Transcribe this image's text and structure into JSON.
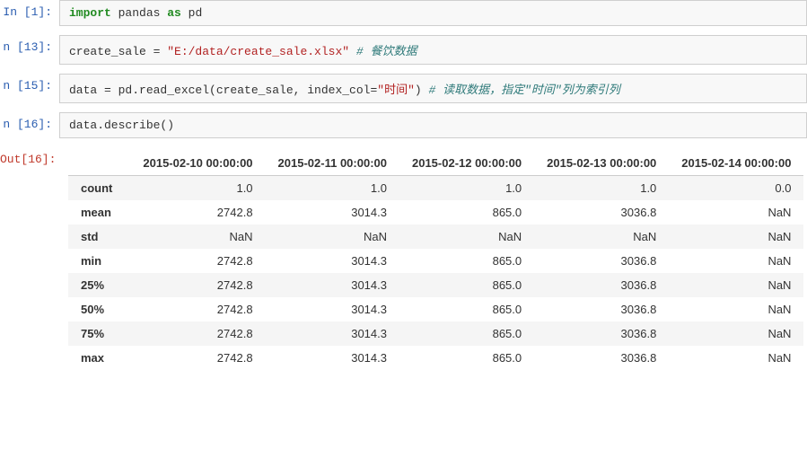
{
  "cells": [
    {
      "prompt": "In  [1]:",
      "code_html": "<span class='kw-green'>import</span> <span class='plain'>pandas</span> <span class='kw-green'>as</span> <span class='plain'>pd</span>"
    },
    {
      "prompt": "n [13]:",
      "code_html": "<span class='plain'>create_sale = </span><span class='str-red'>\"E:/data/create_sale.xlsx\"</span>   <span class='comment-teal'># 餐饮数据</span>"
    },
    {
      "prompt": "n [15]:",
      "code_html": "<span class='plain'>data = pd.read_excel(create_sale, index_col=</span><span class='str-red'>\"时间\"</span><span class='plain'>)</span>   <span class='comment-teal'># 读取数据，指定\"时间\"列为索引列</span>"
    },
    {
      "prompt": "n [16]:",
      "code_html": "<span class='plain'>data.describe()</span>"
    }
  ],
  "output_prompt": "Out[16]:",
  "table": {
    "columns": [
      "",
      "2015-02-10 00:00:00",
      "2015-02-11 00:00:00",
      "2015-02-12 00:00:00",
      "2015-02-13 00:00:00",
      "2015-02-14 00:00:00"
    ],
    "rows": [
      {
        "label": "count",
        "values": [
          "1.0",
          "1.0",
          "1.0",
          "1.0",
          "0.0"
        ]
      },
      {
        "label": "mean",
        "values": [
          "2742.8",
          "3014.3",
          "865.0",
          "3036.8",
          "NaN"
        ]
      },
      {
        "label": "std",
        "values": [
          "NaN",
          "NaN",
          "NaN",
          "NaN",
          "NaN"
        ]
      },
      {
        "label": "min",
        "values": [
          "2742.8",
          "3014.3",
          "865.0",
          "3036.8",
          "NaN"
        ]
      },
      {
        "label": "25%",
        "values": [
          "2742.8",
          "3014.3",
          "865.0",
          "3036.8",
          "NaN"
        ]
      },
      {
        "label": "50%",
        "values": [
          "2742.8",
          "3014.3",
          "865.0",
          "3036.8",
          "NaN"
        ]
      },
      {
        "label": "75%",
        "values": [
          "2742.8",
          "3014.3",
          "865.0",
          "3036.8",
          "NaN"
        ]
      },
      {
        "label": "max",
        "values": [
          "2742.8",
          "3014.3",
          "865.0",
          "3036.8",
          "NaN"
        ]
      }
    ]
  }
}
